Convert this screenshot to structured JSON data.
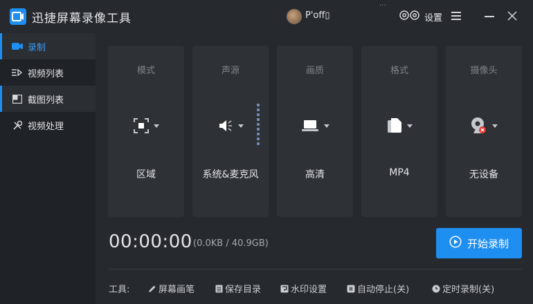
{
  "app": {
    "title": "迅捷屏幕录像工具"
  },
  "header": {
    "user_name": "P'off▯",
    "settings_label": "设置"
  },
  "sidebar": {
    "items": [
      {
        "label": "录制",
        "icon": "video-camera-icon"
      },
      {
        "label": "视频列表",
        "icon": "list-icon"
      },
      {
        "label": "截图列表",
        "icon": "screenshot-list-icon"
      },
      {
        "label": "视频处理",
        "icon": "tools-icon"
      }
    ]
  },
  "cards": [
    {
      "title": "模式",
      "value": "区域",
      "icon": "region-select-icon"
    },
    {
      "title": "声源",
      "value": "系统&麦克风",
      "icon": "speaker-icon"
    },
    {
      "title": "画质",
      "value": "高清",
      "icon": "laptop-icon"
    },
    {
      "title": "格式",
      "value": "MP4",
      "icon": "file-icon"
    },
    {
      "title": "摄像头",
      "value": "无设备",
      "icon": "webcam-off-icon"
    }
  ],
  "status": {
    "timer": "00:00:00",
    "size": "(0.0KB / 40.9GB)"
  },
  "record_button": {
    "label": "开始录制"
  },
  "tools": {
    "label": "工具:",
    "items": [
      {
        "label": "屏幕画笔",
        "icon": "pen-icon"
      },
      {
        "label": "保存目录",
        "icon": "folder-icon"
      },
      {
        "label": "水印设置",
        "icon": "watermark-icon"
      },
      {
        "label": "自动停止(关)",
        "icon": "auto-stop-icon"
      },
      {
        "label": "定时录制(关)",
        "icon": "clock-icon"
      }
    ]
  },
  "colors": {
    "accent": "#1f8ef1",
    "background": "#26292e",
    "card": "#2e3136"
  }
}
